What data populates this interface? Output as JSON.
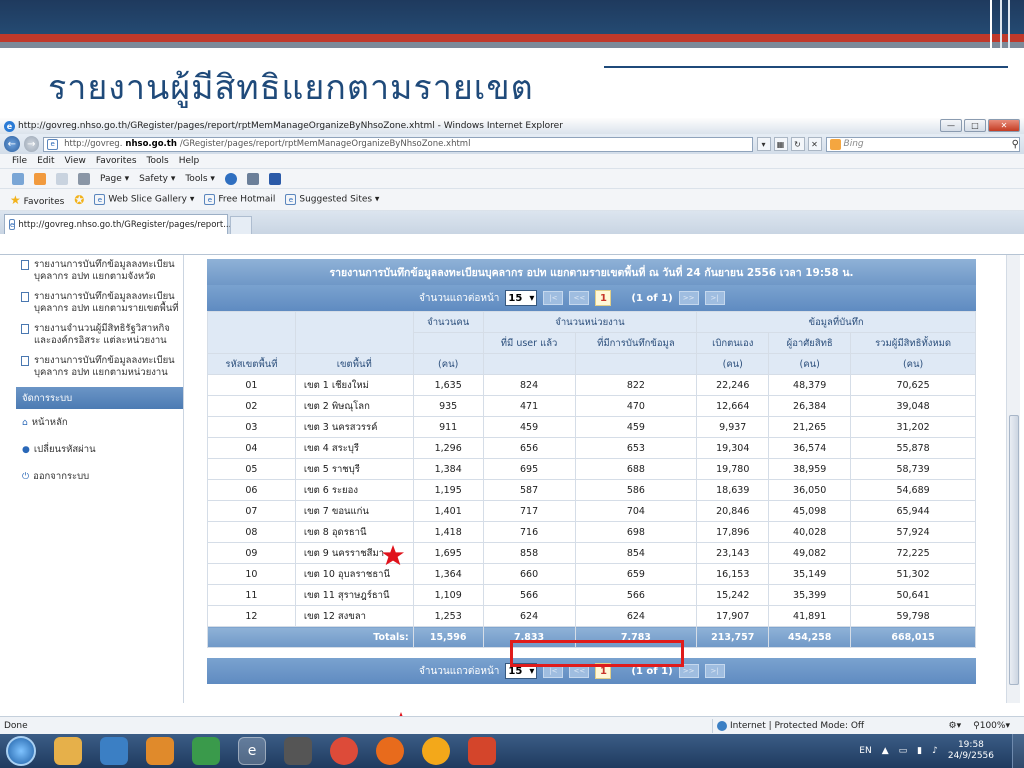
{
  "slide": {
    "title": "รายงานผู้มีสิทธิแยกตามรายเขต"
  },
  "window": {
    "title": "http://govreg.nhso.go.th/GRegister/pages/report/rptMemManageOrganizeByNhsoZone.xhtml - Windows Internet Explorer",
    "url_prefix": "http://govreg.",
    "url_host": "nhso.go.th",
    "url_path": "/GRegister/pages/report/rptMemManageOrganizeByNhsoZone.xhtml",
    "search_placeholder": "Bing"
  },
  "menu": [
    "File",
    "Edit",
    "View",
    "Favorites",
    "Tools",
    "Help"
  ],
  "command_bar": {
    "page": "Page ▾",
    "safety": "Safety ▾",
    "tools": "Tools ▾"
  },
  "favorites": {
    "favorites_label": "Favorites",
    "items": [
      "Web Slice Gallery ▾",
      "Free Hotmail",
      "Suggested Sites ▾"
    ]
  },
  "tab": {
    "label": "http://govreg.nhso.go.th/GRegister/pages/report..."
  },
  "sidebar": {
    "items": [
      "รายงานการบันทึกข้อมูลลงทะเบียนบุคลากร อปท แยกตามจังหวัด",
      "รายงานการบันทึกข้อมูลลงทะเบียนบุคลากร อปท แยกตามรายเขตพื้นที่",
      "รายงานจำนวนผู้มีสิทธิรัฐวิสาหกิจ และองค์กรอิสระ แต่ละหน่วยงาน",
      "รายงานการบันทึกข้อมูลลงทะเบียนบุคลากร อปท แยกตามหน่วยงาน"
    ],
    "section_header": "จัดการระบบ",
    "links": [
      "หน้าหลัก",
      "เปลี่ยนรหัสผ่าน",
      "ออกจากระบบ"
    ]
  },
  "report": {
    "title": "รายงานการบันทึกข้อมูลลงทะเบียนบุคลากร อปท แยกตามรายเขตพื้นที่ ณ วันที่ 24 กันยายน 2556 เวลา 19:58 น.",
    "pager": {
      "label": "จำนวนแถวต่อหน้า",
      "rows_per_page": "15",
      "page": "1",
      "of": "(1 of 1)"
    },
    "headers": {
      "zone_code": "รหัสเขตพื้นที่",
      "zone": "เขตพื้นที่",
      "people": "จำนวนคน",
      "units": "จำนวนหน่วยงาน",
      "units_with_user": "ที่มี user แล้ว",
      "units_recorded": "ที่มีการบันทึกข้อมูล",
      "recorded": "ข้อมูลที่บันทึก",
      "self_pay": "เบิกตนเอง",
      "dependents": "ผู้อาศัยสิทธิ",
      "total_rights": "รวมผู้มีสิทธิทั้งหมด",
      "unit_person": "(คน)"
    },
    "rows": [
      [
        "01",
        "เขต 1 เชียงใหม่",
        "1,635",
        "824",
        "822",
        "22,246",
        "48,379",
        "70,625"
      ],
      [
        "02",
        "เขต 2 พิษณุโลก",
        "935",
        "471",
        "470",
        "12,664",
        "26,384",
        "39,048"
      ],
      [
        "03",
        "เขต 3 นครสวรรค์",
        "911",
        "459",
        "459",
        "9,937",
        "21,265",
        "31,202"
      ],
      [
        "04",
        "เขต 4 สระบุรี",
        "1,296",
        "656",
        "653",
        "19,304",
        "36,574",
        "55,878"
      ],
      [
        "05",
        "เขต 5 ราชบุรี",
        "1,384",
        "695",
        "688",
        "19,780",
        "38,959",
        "58,739"
      ],
      [
        "06",
        "เขต 6 ระยอง",
        "1,195",
        "587",
        "586",
        "18,639",
        "36,050",
        "54,689"
      ],
      [
        "07",
        "เขต 7 ขอนแก่น",
        "1,401",
        "717",
        "704",
        "20,846",
        "45,098",
        "65,944"
      ],
      [
        "08",
        "เขต 8 อุดรธานี",
        "1,418",
        "716",
        "698",
        "17,896",
        "40,028",
        "57,924"
      ],
      [
        "09",
        "เขต 9 นครราชสีมา",
        "1,695",
        "858",
        "854",
        "23,143",
        "49,082",
        "72,225"
      ],
      [
        "10",
        "เขต 10 อุบลราชธานี",
        "1,364",
        "660",
        "659",
        "16,153",
        "35,149",
        "51,302"
      ],
      [
        "11",
        "เขต 11 สุราษฎร์ธานี",
        "1,109",
        "566",
        "566",
        "15,242",
        "35,399",
        "50,641"
      ],
      [
        "12",
        "เขต 12 สงขลา",
        "1,253",
        "624",
        "624",
        "17,907",
        "41,891",
        "59,798"
      ]
    ],
    "totals": {
      "label": "Totals:",
      "values": [
        "15,596",
        "7,833",
        "7,783",
        "213,757",
        "454,258",
        "668,015"
      ]
    }
  },
  "status": {
    "left": "Done",
    "zone": "Internet | Protected Mode: Off",
    "zoom": "100%"
  },
  "taskbar": {
    "lang": "EN",
    "time": "19:58",
    "date": "24/9/2556"
  },
  "colors": {
    "accent_blue": "#6f98c7",
    "highlight_red": "#e01b1b",
    "star_red": "#e0121b"
  }
}
